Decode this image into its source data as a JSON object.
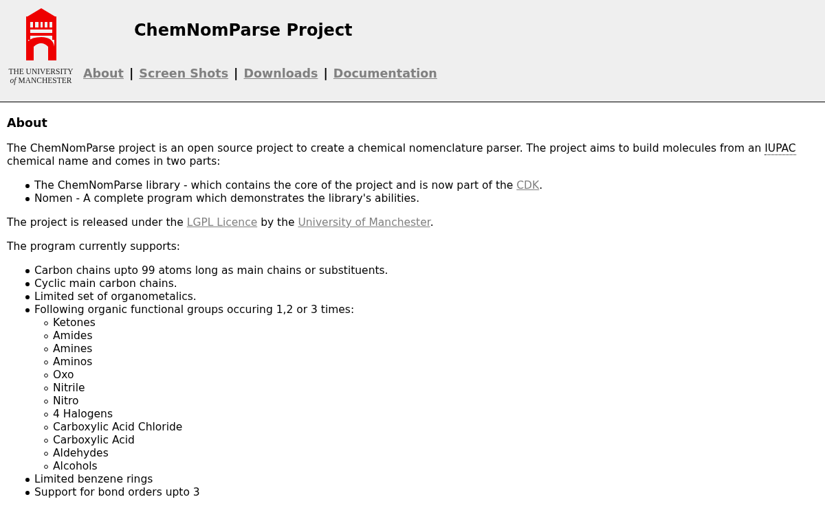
{
  "header": {
    "logo_lines": [
      "THE UNIVERSITY",
      "*of* MANCHESTER"
    ],
    "title": "ChemNomParse Project",
    "nav": [
      {
        "label": "About"
      },
      {
        "label": "Screen Shots"
      },
      {
        "label": "Downloads"
      },
      {
        "label": "Documentation"
      }
    ],
    "separator": "|"
  },
  "content": [
    {
      "kind": "heading",
      "segments": [
        {
          "kind": "text",
          "text": "About"
        }
      ]
    },
    {
      "kind": "paragraph",
      "segments": [
        {
          "kind": "text",
          "text": "The ChemNomParse project is an open source project to create a chemical nomenclature parser. The project aims to build molecules from an "
        },
        {
          "kind": "abbr",
          "text": "IUPAC"
        },
        {
          "kind": "text",
          "text": " chemical name and comes in two parts:"
        }
      ]
    },
    {
      "kind": "list",
      "items": [
        {
          "segments": [
            {
              "kind": "text",
              "text": "The ChemNomParse library - which contains the core of the project and is now part of the "
            },
            {
              "kind": "link",
              "text": "CDK"
            },
            {
              "kind": "text",
              "text": "."
            }
          ]
        },
        {
          "segments": [
            {
              "kind": "text",
              "text": "Nomen - A complete program which demonstrates the library's abilities."
            }
          ]
        }
      ]
    },
    {
      "kind": "paragraph",
      "segments": [
        {
          "kind": "text",
          "text": "The project is released under the "
        },
        {
          "kind": "link",
          "text": "LGPL Licence"
        },
        {
          "kind": "text",
          "text": " by the "
        },
        {
          "kind": "link",
          "text": "University of Manchester"
        },
        {
          "kind": "text",
          "text": "."
        }
      ]
    },
    {
      "kind": "paragraph",
      "segments": [
        {
          "kind": "text",
          "text": "The program currently supports:"
        }
      ]
    },
    {
      "kind": "list",
      "items": [
        {
          "segments": [
            {
              "kind": "text",
              "text": "Carbon chains upto 99 atoms long as main chains or substituents."
            }
          ]
        },
        {
          "segments": [
            {
              "kind": "text",
              "text": "Cyclic main carbon chains."
            }
          ]
        },
        {
          "segments": [
            {
              "kind": "text",
              "text": "Limited set of organometalics."
            }
          ]
        },
        {
          "segments": [
            {
              "kind": "text",
              "text": "Following organic functional groups occuring 1,2 or 3 times:"
            }
          ],
          "children": [
            {
              "segments": [
                {
                  "kind": "text",
                  "text": "Ketones"
                }
              ]
            },
            {
              "segments": [
                {
                  "kind": "text",
                  "text": "Amides"
                }
              ]
            },
            {
              "segments": [
                {
                  "kind": "text",
                  "text": "Amines"
                }
              ]
            },
            {
              "segments": [
                {
                  "kind": "text",
                  "text": "Aminos"
                }
              ]
            },
            {
              "segments": [
                {
                  "kind": "text",
                  "text": "Oxo"
                }
              ]
            },
            {
              "segments": [
                {
                  "kind": "text",
                  "text": "Nitrile"
                }
              ]
            },
            {
              "segments": [
                {
                  "kind": "text",
                  "text": "Nitro"
                }
              ]
            },
            {
              "segments": [
                {
                  "kind": "text",
                  "text": "4 Halogens"
                }
              ]
            },
            {
              "segments": [
                {
                  "kind": "text",
                  "text": "Carboxylic Acid Chloride"
                }
              ]
            },
            {
              "segments": [
                {
                  "kind": "text",
                  "text": "Carboxylic Acid"
                }
              ]
            },
            {
              "segments": [
                {
                  "kind": "text",
                  "text": "Aldehydes"
                }
              ]
            },
            {
              "segments": [
                {
                  "kind": "text",
                  "text": "Alcohols"
                }
              ]
            }
          ]
        },
        {
          "segments": [
            {
              "kind": "text",
              "text": "Limited benzene rings"
            }
          ]
        },
        {
          "segments": [
            {
              "kind": "text",
              "text": "Support for bond orders upto 3"
            }
          ]
        }
      ]
    }
  ]
}
